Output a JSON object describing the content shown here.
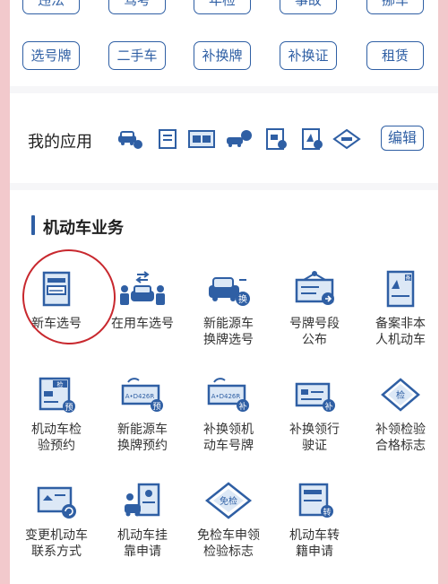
{
  "top_tags_partial": [
    "违法",
    "驾考",
    "年检",
    "事故",
    "挪车"
  ],
  "top_tags": [
    "选号牌",
    "二手车",
    "补换牌",
    "补换证",
    "租赁"
  ],
  "my_apps": {
    "title": "我的应用",
    "icons": [
      "car-badge-icon",
      "document-icon",
      "plate-board-icon",
      "car-move-icon",
      "flag-doc-icon",
      "cert-doc-icon",
      "exempt-badge-icon"
    ],
    "edit_label": "编辑"
  },
  "vehicle_business": {
    "title": "机动车业务",
    "items": [
      {
        "line1": "新车选号",
        "line2": ""
      },
      {
        "line1": "在用车选号",
        "line2": ""
      },
      {
        "line1": "新能源车",
        "line2": "换牌选号"
      },
      {
        "line1": "号牌号段",
        "line2": "公布"
      },
      {
        "line1": "备案非本",
        "line2": "人机动车"
      },
      {
        "line1": "机动车检",
        "line2": "验预约"
      },
      {
        "line1": "新能源车",
        "line2": "换牌预约"
      },
      {
        "line1": "补换领机",
        "line2": "动车号牌"
      },
      {
        "line1": "补换领行",
        "line2": "驶证"
      },
      {
        "line1": "补领检验",
        "line2": "合格标志"
      },
      {
        "line1": "变更机动车",
        "line2": "联系方式"
      },
      {
        "line1": "机动车挂",
        "line2": "靠申请"
      },
      {
        "line1": "免检车申领",
        "line2": "检验标志"
      },
      {
        "line1": "机动车转",
        "line2": "籍申请"
      }
    ],
    "icon_text": {
      "yu": "预",
      "huan": "换",
      "bu": "补",
      "jian": "检",
      "bei": "备",
      "zhuan": "转",
      "mianjian": "免检",
      "plate": "A•D426R"
    }
  },
  "colors": {
    "accent": "#2f5fa4",
    "light": "#dce8f6",
    "annotation": "#c8282e"
  }
}
